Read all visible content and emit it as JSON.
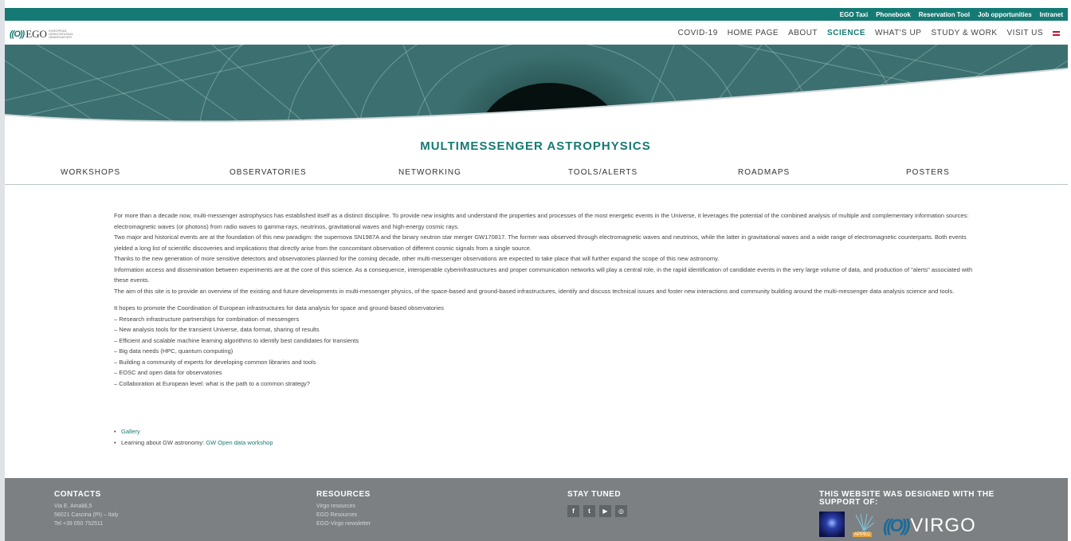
{
  "topbar": {
    "links": [
      "EGO Taxi",
      "Phonebook",
      "Reservation Tool",
      "Job opportunities",
      "Intranet"
    ]
  },
  "logo": {
    "mark": "((O))",
    "word": "EGO",
    "sub": "EUROPEAN GRAVITATIONAL OBSERVATORY"
  },
  "mainnav": {
    "items": [
      "COVID-19",
      "HOME PAGE",
      "ABOUT",
      "SCIENCE",
      "WHAT'S UP",
      "STUDY & WORK",
      "VISIT US"
    ],
    "active": "SCIENCE"
  },
  "page": {
    "title": "MULTIMESSENGER ASTROPHYSICS"
  },
  "subnav": {
    "items": [
      "WORKSHOPS",
      "OBSERVATORIES",
      "NETWORKING",
      "TOOLS/ALERTS",
      "ROADMAPS",
      "POSTERS"
    ]
  },
  "content": {
    "paragraphs": [
      "For more than a decade now, multi-messenger astrophysics has established itself as a distinct discipline. To provide new insights and understand the properties and processes of the most energetic events in the Universe, it leverages the potential of the combined analysis of multiple and complementary information sources: electromagnetic waves (or photons) from radio waves to gamma-rays, neutrinos, gravitational waves and high-energy cosmic rays.",
      "Two major and historical events are at the foundation of this new paradigm: the supernova SN1987A and the binary neutron star merger GW170817. The former was observed through electromagnetic waves and neutrinos, while the latter in gravitational waves and a wide range of electromagnetic counterparts. Both events yielded a long list of scientific discoveries and implications that directly arise from the concomitant observation of different cosmic signals from a single source.",
      "Thanks to the new generation of more sensitive detectors and observatories planned for the coming decade, other multi-messenger observations are expected to take place that will further expand the scope of this new astronomy.",
      "Information access and dissemination between experiments are at the core of this science. As a consequence, interoperable cyberinfrastructures and proper communication networks will play a central role, in the rapid identification of candidate events in the very large volume of data, and production of \"alerts\" associated with these events.",
      "The aim of this site is to provide an overview of the existing and future developments in multi-messenger physics, of the space-based and ground-based infrastructures, identify and discuss technical issues and foster new interactions and community building around the multi-messenger data analysis science and tools."
    ],
    "list_intro": "It hopes to promote the Coordination of European infrastructures for data analysis for space and ground-based observatories",
    "list": [
      "– Research infrastructure partnerships for combination of messengers",
      "– New analysis tools for the transient Universe, data format, sharing of results",
      "– Efficient and scalable machine learning algorithms to identify best candidates for transients",
      "– Big data needs (HPC, quantum computing)",
      "– Building a community of experts for developing common libraries and tools",
      "– EOSC and open data for observatories",
      "– Collaboration at European level: what is the path to a common strategy?"
    ]
  },
  "links": {
    "gallery": "Gallery",
    "learning_prefix": "Learning about GW astronomy: ",
    "learning_link": "GW Open data workshop"
  },
  "footer": {
    "contacts": {
      "title": "CONTACTS",
      "lines": [
        "Via E. Amaldi,5",
        "56021 Cascina (PI) – Italy",
        "Tel +39 050 752511"
      ]
    },
    "resources": {
      "title": "RESOURCES",
      "lines": [
        "Virgo resources",
        "EGO Resources",
        "EGO-Virgo newsletter"
      ]
    },
    "stay_tuned": {
      "title": "STAY TUNED",
      "icons": [
        "f",
        "t",
        "▶",
        "◎"
      ]
    },
    "support": {
      "title": "THIS WEBSITE WAS DESIGNED WITH THE SUPPORT OF:",
      "appec": "APPEC",
      "virgo_mark": "((O))",
      "virgo_word": "VIRGO"
    }
  }
}
